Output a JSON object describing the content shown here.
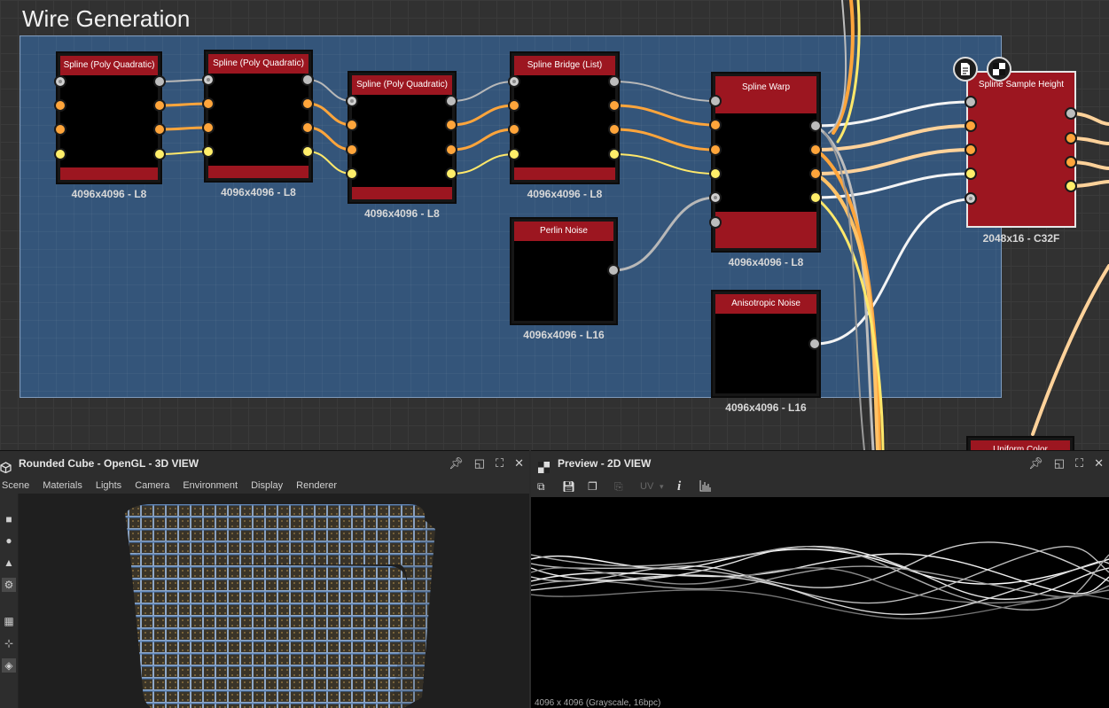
{
  "graph": {
    "frame_title": "Wire Generation",
    "nodes": [
      {
        "id": "spline-poly-1",
        "title": "Spline (Poly Quadratic)",
        "label": "4096x4096 - L8"
      },
      {
        "id": "spline-poly-2",
        "title": "Spline (Poly Quadratic)",
        "label": "4096x4096 - L8"
      },
      {
        "id": "spline-poly-3",
        "title": "Spline (Poly Quadratic)",
        "label": "4096x4096 - L8"
      },
      {
        "id": "spline-bridge",
        "title": "Spline Bridge (List)",
        "label": "4096x4096 - L8"
      },
      {
        "id": "perlin-noise",
        "title": "Perlin Noise",
        "label": "4096x4096 - L16"
      },
      {
        "id": "spline-warp",
        "title": "Spline Warp",
        "label": "4096x4096 - L8"
      },
      {
        "id": "aniso-noise",
        "title": "Anisotropic Noise",
        "label": "4096x4096 - L16"
      },
      {
        "id": "spline-sample-height",
        "title": "Spline Sample Height",
        "label": "2048x16 - C32F"
      },
      {
        "id": "uniform-color",
        "title": "Uniform Color",
        "label": ""
      }
    ],
    "colors": {
      "wire_orange": "#ffa53b",
      "wire_yellow": "#ffe86a",
      "wire_gray": "#b8b8b8",
      "wire_white": "#f4f4f4",
      "node_red": "#9c1620",
      "frame_blue": "#34557a"
    }
  },
  "view3d": {
    "title": "Rounded Cube - OpenGL - 3D VIEW",
    "menu": [
      "Scene",
      "Materials",
      "Lights",
      "Camera",
      "Environment",
      "Display",
      "Renderer"
    ],
    "sidebar_icons": [
      "camera-icon",
      "light-bulb-icon",
      "environment-icon",
      "settings-icon",
      "grid-icon",
      "axis-icon",
      "cube-icon"
    ]
  },
  "view2d": {
    "title": "Preview - 2D VIEW",
    "toolbar": {
      "uv_label": "UV",
      "info_label": "i"
    },
    "status": "4096 x 4096 (Grayscale, 16bpc)"
  }
}
